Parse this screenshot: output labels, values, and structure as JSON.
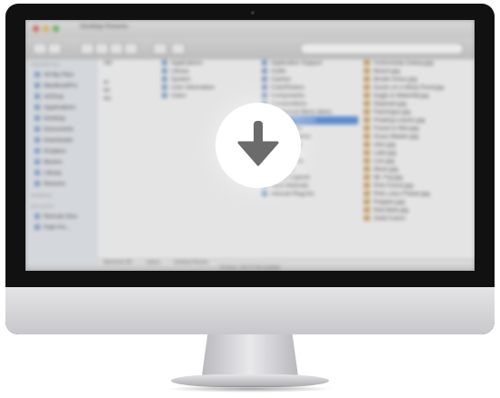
{
  "finder": {
    "window_title": "Desktop Pictures",
    "sidebar": {
      "favorites_header": "FAVORITES",
      "favorites": [
        "All My Files",
        "MacBookPro",
        "AirDrop",
        "Applications",
        "Desktop",
        "Documents",
        "Downloads",
        "Dropbox",
        "Movies",
        "Library",
        "Recents"
      ],
      "shared_header": "SHARED",
      "devices_header": "DEVICES",
      "devices": [
        "Remote Disc",
        "Path Fin..."
      ]
    },
    "column1": [
      "HD",
      "er",
      "ler",
      "les"
    ],
    "column2": [
      "Applications",
      "Library",
      "System",
      "User Information",
      "Users"
    ],
    "column3": [
      "Application Support",
      "Audio",
      "Caches",
      "ColorPickers",
      "Components",
      "Compositions",
      "Contextual Menu Items",
      "Desktop Pictures",
      "Dictionaries",
      "Documentation",
      "Filesystems",
      "Fonts",
      "Frameworks",
      "Graphics",
      "Image Capture",
      "Input Methods",
      "Internet Plug-Ins"
    ],
    "column4": [
      "Andromeda Galaxy.jpg",
      "Beach.jpg",
      "Bristle Grass.jpg",
      "Ducks on a Misty Pond.jpg",
      "Eagle & Waterfall.jpg",
      "Elephant.jpg",
      "Flamingos.jpg",
      "Floating Leaves.jpg",
      "Forest in Mist.jpg",
      "Grass Blades.jpg",
      "Isles.jpg",
      "Lake.jpg",
      "Lion.jpg",
      "Moon.jpg",
      "Mt. Fuji.jpg",
      "Pink Forest.jpg",
      "Pink Lotus Flower.jpg",
      "Poppies.jpg",
      "Red Bells.jpg",
      "Solid Colors"
    ],
    "selected_col3_index": 7,
    "pathbar": [
      "Macintosh HD",
      "Library",
      "Desktop Pictures"
    ],
    "status": "20 items, 102.25 GB available"
  },
  "overlay": {
    "icon": "download-arrow-icon",
    "circle_color": "#ffffff",
    "arrow_color": "#6b6b6b"
  }
}
